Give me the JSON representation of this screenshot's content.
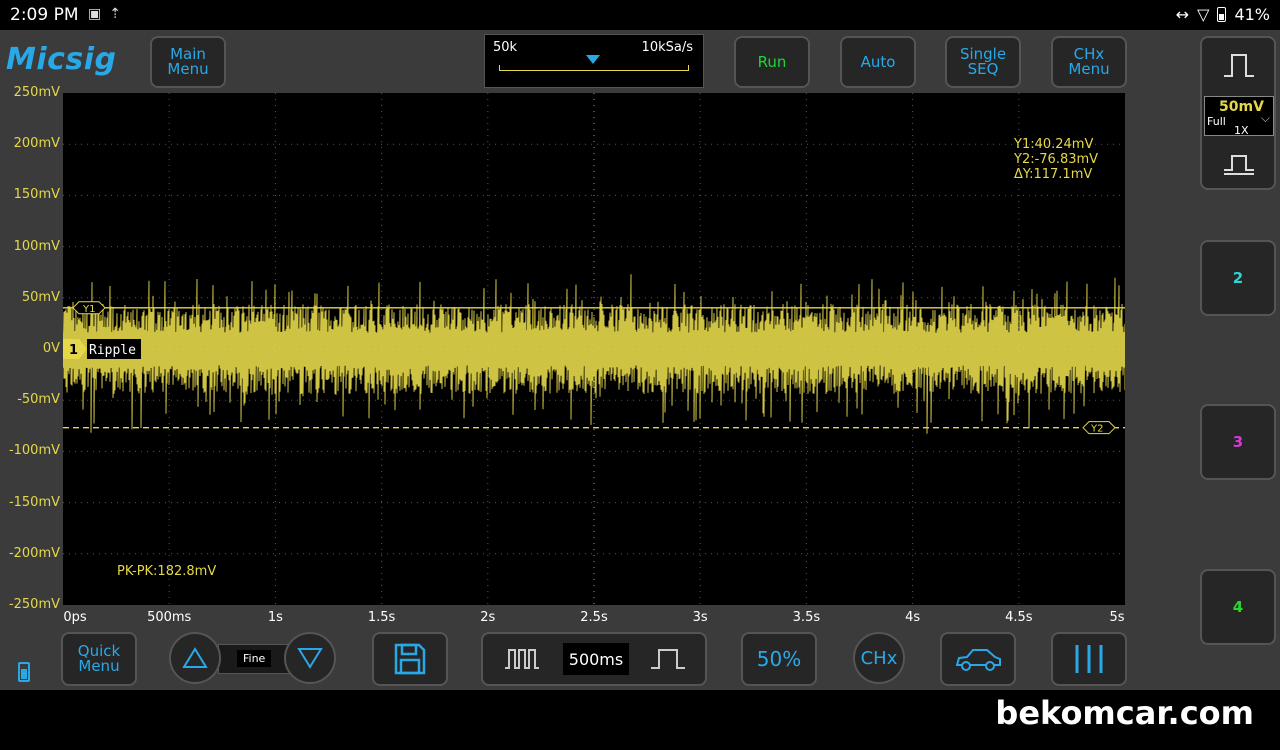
{
  "status": {
    "time": "2:09 PM",
    "left_icons": [
      "image-icon",
      "upload-icon"
    ],
    "right_icons": [
      "link-icon",
      "wifi-icon",
      "battery-icon"
    ],
    "battery": "41%"
  },
  "app": {
    "logo": "Micsig",
    "toolbar": {
      "main_menu": "Main\nMenu",
      "run": "Run",
      "auto": "Auto",
      "single_seq": "Single\nSEQ",
      "chx_menu": "CHx\nMenu"
    },
    "timebase": {
      "memory_depth": "50k",
      "sample_rate": "10kSa/s"
    },
    "channel1": {
      "volts_div": "50mV",
      "coupling": "Full",
      "probe": "1X",
      "label": "Ripple",
      "number": "1"
    },
    "channels": [
      {
        "number": "2",
        "color": "#2ad6d6"
      },
      {
        "number": "3",
        "color": "#d63ad6"
      },
      {
        "number": "4",
        "color": "#2ad62a"
      }
    ],
    "y_axis": [
      "250mV",
      "200mV",
      "150mV",
      "100mV",
      "50mV",
      "0V",
      "-50mV",
      "-100mV",
      "-150mV",
      "-200mV",
      "-250mV"
    ],
    "x_axis": [
      "0ps",
      "500ms",
      "1s",
      "1.5s",
      "2s",
      "2.5s",
      "3s",
      "3.5s",
      "4s",
      "4.5s",
      "5s"
    ],
    "measurements": {
      "y1": "Y1:40.24mV",
      "y2": "Y2:-76.83mV",
      "dy": "ΔY:117.1mV",
      "pkpk": "PK-PK:182.8mV"
    },
    "cursors": {
      "y1_label": "Y1",
      "y2_label": "Y2",
      "y1_mv": 40.24,
      "y2_mv": -76.83
    },
    "bottom": {
      "quick_menu": "Quick\nMenu",
      "fine": "Fine",
      "timebase_value": "500ms",
      "fifty_percent": "50%",
      "chx": "CHx"
    },
    "colors": {
      "accent": "#29a8e8",
      "ch1": "#e5d84a",
      "run": "#22d23a"
    }
  },
  "footer": {
    "watermark": "bekomcar.com"
  }
}
